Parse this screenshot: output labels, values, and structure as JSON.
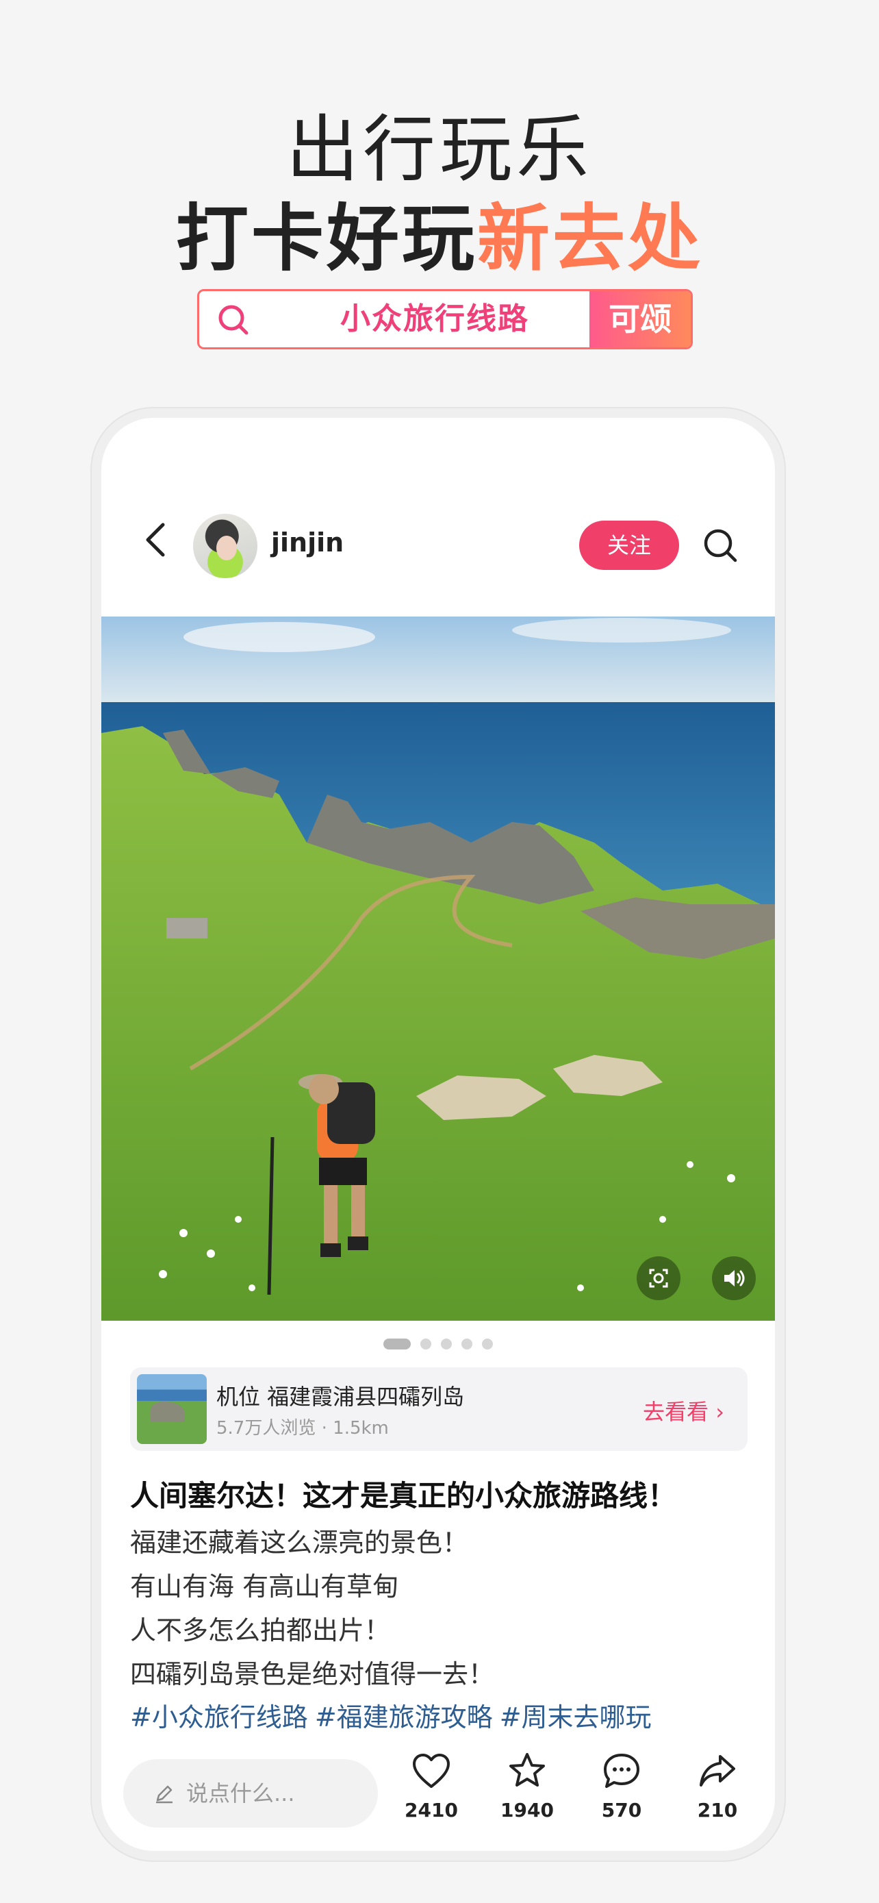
{
  "promo": {
    "line1": "出行玩乐",
    "line2_main": "打卡好玩",
    "line2_accent": "新去处",
    "accent_color": "#ff7a52",
    "search_query": "小众旅行线路",
    "search_button": "可颂",
    "search_icon": "search-icon"
  },
  "header": {
    "username": "jinjin",
    "follow_label": "关注",
    "back_icon": "chevron-left-icon",
    "search_icon": "search-icon"
  },
  "carousel": {
    "total": 5,
    "current": 1
  },
  "location": {
    "title": "机位 福建霞浦县四礵列岛",
    "views": "5.7万人浏览",
    "separator": "·",
    "distance": "1.5km",
    "link_label": "去看看 ›"
  },
  "post": {
    "title": "人间塞尔达！这才是真正的小众旅游路线！",
    "lines": [
      "福建还藏着这么漂亮的景色！",
      "有山有海 有高山有草甸",
      "人不多怎么拍都出片！",
      "四礵列岛景色是绝对值得一去！"
    ],
    "tags": [
      "#小众旅行线路",
      "#福建旅游攻略",
      "#周末去哪玩"
    ]
  },
  "actions": {
    "comment_placeholder": "说点什么...",
    "likes": "2410",
    "favorites": "1940",
    "comments": "570",
    "shares": "210"
  }
}
